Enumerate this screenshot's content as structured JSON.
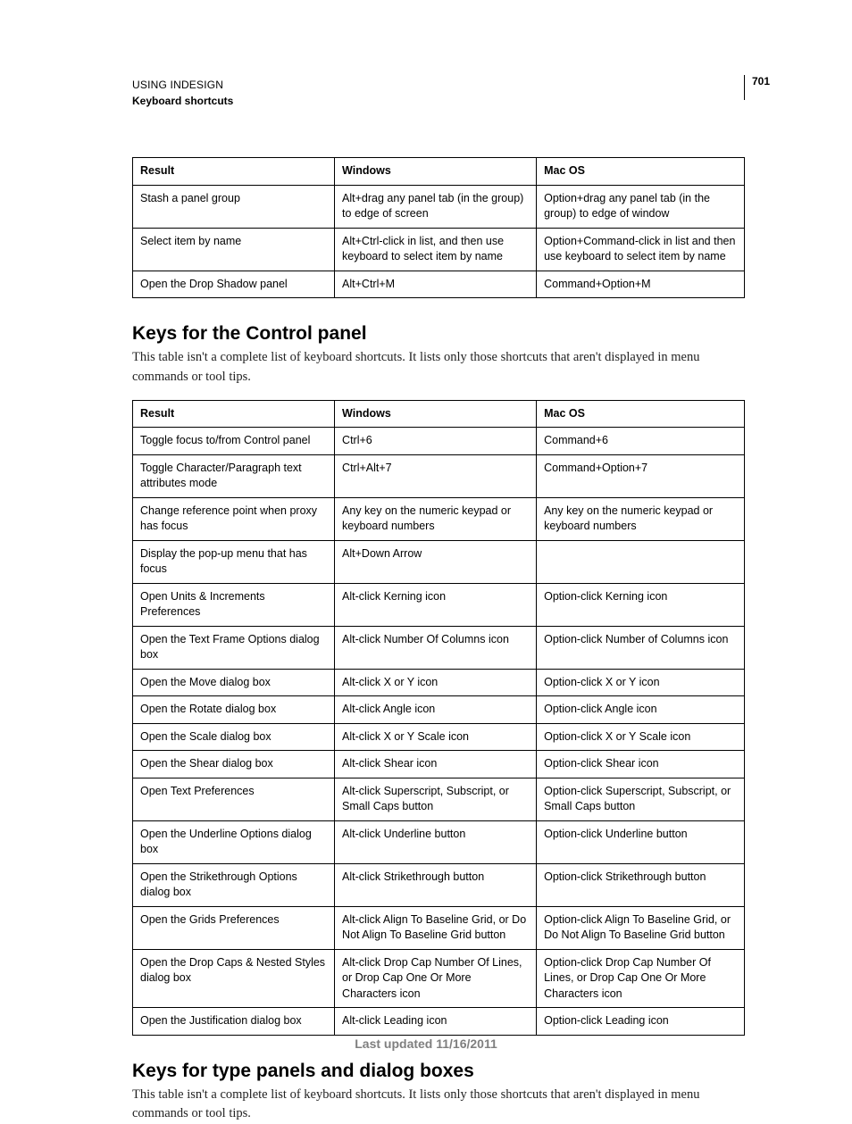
{
  "header": {
    "product": "USING INDESIGN",
    "section": "Keyboard shortcuts",
    "page_number": "701"
  },
  "table1": {
    "headers": {
      "result": "Result",
      "windows": "Windows",
      "macos": "Mac OS"
    },
    "rows": [
      {
        "result": "Stash a panel group",
        "windows": "Alt+drag any panel tab (in the group) to edge of screen",
        "macos": "Option+drag any panel tab (in the group) to edge of window"
      },
      {
        "result": "Select item by name",
        "windows": "Alt+Ctrl-click in list, and then use keyboard to select item by name",
        "macos": "Option+Command-click in list and then use keyboard to select item by name"
      },
      {
        "result": "Open the Drop Shadow panel",
        "windows": "Alt+Ctrl+M",
        "macos": "Command+Option+M"
      }
    ]
  },
  "section2": {
    "title": "Keys for the Control panel",
    "intro": "This table isn't a complete list of keyboard shortcuts. It lists only those shortcuts that aren't displayed in menu commands or tool tips."
  },
  "table2": {
    "headers": {
      "result": "Result",
      "windows": "Windows",
      "macos": "Mac OS"
    },
    "rows": [
      {
        "result": "Toggle focus to/from Control panel",
        "windows": "Ctrl+6",
        "macos": "Command+6"
      },
      {
        "result": "Toggle Character/Paragraph text attributes mode",
        "windows": "Ctrl+Alt+7",
        "macos": "Command+Option+7"
      },
      {
        "result": "Change reference point when proxy has focus",
        "windows": "Any key on the numeric keypad or keyboard numbers",
        "macos": "Any key on the numeric keypad or keyboard numbers"
      },
      {
        "result": "Display the pop-up menu that has focus",
        "windows": "Alt+Down Arrow",
        "macos": ""
      },
      {
        "result": "Open Units & Increments Preferences",
        "windows": "Alt-click Kerning icon",
        "macos": "Option-click Kerning icon"
      },
      {
        "result": "Open the Text Frame Options dialog box",
        "windows": "Alt-click Number Of Columns icon",
        "macos": "Option-click Number of Columns icon"
      },
      {
        "result": "Open the Move dialog box",
        "windows": "Alt-click X or Y icon",
        "macos": "Option-click X or Y icon"
      },
      {
        "result": "Open the Rotate dialog box",
        "windows": "Alt-click Angle icon",
        "macos": "Option-click Angle icon"
      },
      {
        "result": "Open the Scale dialog box",
        "windows": "Alt-click X or Y Scale icon",
        "macos": "Option-click X or Y Scale icon"
      },
      {
        "result": "Open the Shear dialog box",
        "windows": "Alt-click Shear icon",
        "macos": "Option-click Shear icon"
      },
      {
        "result": "Open Text Preferences",
        "windows": "Alt-click Superscript, Subscript, or Small Caps button",
        "macos": "Option-click Superscript, Subscript, or Small Caps button"
      },
      {
        "result": "Open the Underline Options dialog box",
        "windows": "Alt-click Underline button",
        "macos": "Option-click Underline button"
      },
      {
        "result": "Open the Strikethrough Options dialog box",
        "windows": "Alt-click Strikethrough button",
        "macos": "Option-click Strikethrough button"
      },
      {
        "result": "Open the Grids Preferences",
        "windows": "Alt-click Align To Baseline Grid, or Do Not Align To Baseline Grid button",
        "macos": "Option-click Align To Baseline Grid, or Do Not Align To Baseline Grid button"
      },
      {
        "result": "Open the Drop Caps & Nested Styles dialog box",
        "windows": "Alt-click Drop Cap Number Of Lines, or Drop Cap One Or More Characters icon",
        "macos": "Option-click Drop Cap Number Of Lines, or Drop Cap One Or More Characters icon"
      },
      {
        "result": "Open the Justification dialog box",
        "windows": "Alt-click Leading icon",
        "macos": "Option-click Leading icon"
      }
    ]
  },
  "section3": {
    "title": "Keys for type panels and dialog boxes",
    "intro": "This table isn't a complete list of keyboard shortcuts. It lists only those shortcuts that aren't displayed in menu commands or tool tips."
  },
  "footer": {
    "updated": "Last updated 11/16/2011"
  }
}
